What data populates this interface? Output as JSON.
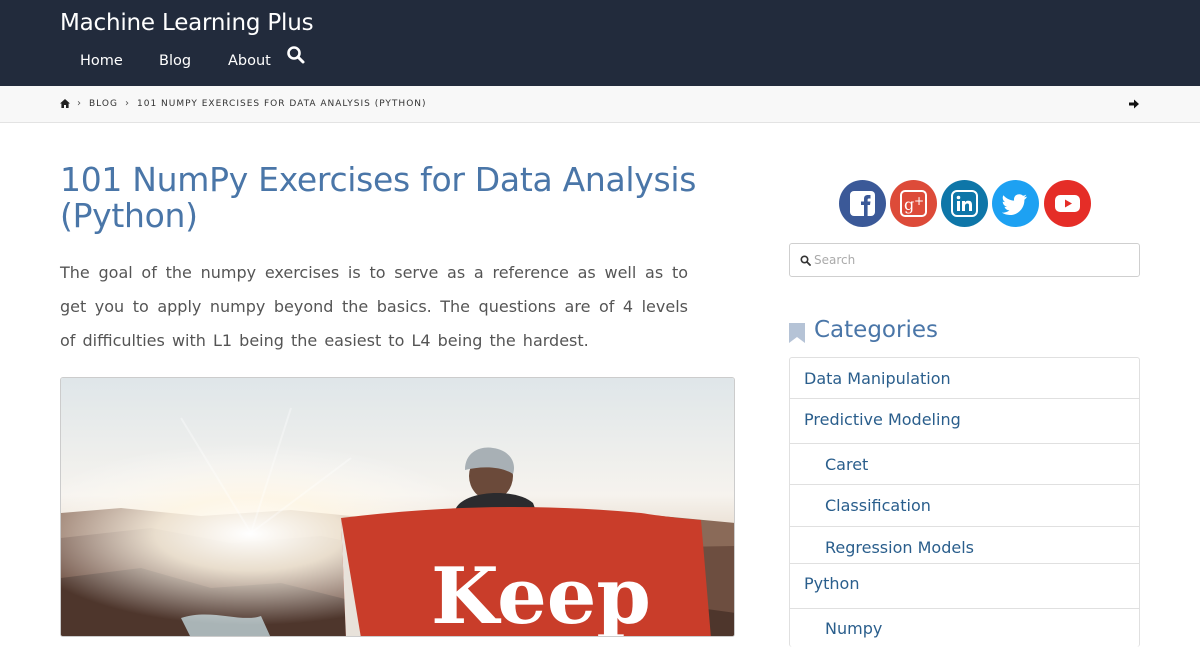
{
  "header": {
    "site_title": "Machine Learning Plus",
    "nav": [
      "Home",
      "Blog",
      "About"
    ]
  },
  "breadcrumb": {
    "items": [
      "BLOG",
      "101 NUMPY EXERCISES FOR DATA ANALYSIS (PYTHON)"
    ]
  },
  "post": {
    "title": "101 NumPy Exercises for Data Analysis (Python)",
    "excerpt": "The goal of the numpy exercises is to serve as a reference as well as to get you to apply numpy beyond the basics. The questions are of 4 levels of difficulties with L1 being the easiest to L4 being the hardest.",
    "hero_text": "Keep"
  },
  "sidebar": {
    "social": [
      {
        "name": "facebook",
        "color": "#3b5998"
      },
      {
        "name": "google-plus",
        "color": "#dd4b39"
      },
      {
        "name": "linkedin",
        "color": "#0e76a8"
      },
      {
        "name": "twitter",
        "color": "#1da1f2"
      },
      {
        "name": "youtube",
        "color": "#e52d27"
      }
    ],
    "search_placeholder": "Search",
    "categories_heading": "Categories",
    "categories": [
      {
        "label": "Data Manipulation",
        "level": 0
      },
      {
        "label": "Predictive Modeling",
        "level": 0
      },
      {
        "label": "Caret",
        "level": 1
      },
      {
        "label": "Classification",
        "level": 1
      },
      {
        "label": "Regression Models",
        "level": 1
      },
      {
        "label": "Python",
        "level": 0
      },
      {
        "label": "Numpy",
        "level": 1
      }
    ]
  },
  "colors": {
    "header_bg": "#222b3c",
    "accent": "#4a76a8",
    "link": "#2a5e8c"
  }
}
